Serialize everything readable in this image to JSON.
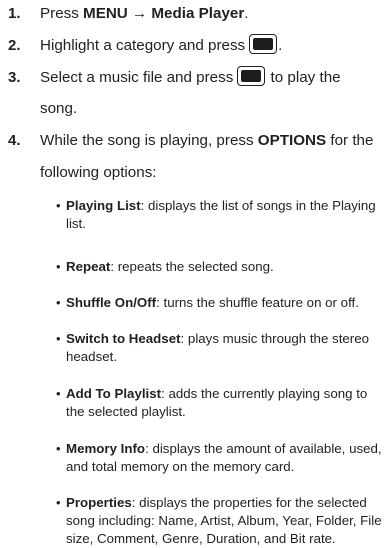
{
  "steps": [
    {
      "number": "1.",
      "parts": {
        "a": "Press ",
        "b": "MENU → Media Player",
        "c": "."
      }
    },
    {
      "number": "2.",
      "parts": {
        "a": "Highlight a category and press",
        "c": "."
      }
    },
    {
      "number": "3.",
      "parts": {
        "a": "Select a music file and press",
        "c": " to play the",
        "line2": "song."
      }
    },
    {
      "number": "4.",
      "parts": {
        "a": "While the song is playing, press ",
        "b": "OPTIONS",
        "c": " for the",
        "line2": "following options:"
      }
    }
  ],
  "key_icon_name": "ok-key-icon",
  "options": [
    {
      "term": "Playing List",
      "desc": ": displays the list of songs in the Playing list."
    },
    {
      "term": "Repeat",
      "desc": ": repeats the selected song."
    },
    {
      "term": "Shuffle On/Off",
      "desc": ": turns the shuffle feature on or off."
    },
    {
      "term": "Switch to Headset",
      "desc": ": plays music through the stereo headset."
    },
    {
      "term": "Add To Playlist",
      "desc": ": adds the currently playing song to the selected playlist."
    },
    {
      "term": "Memory Info",
      "desc": ": displays the amount of available, used, and total memory on the memory card."
    },
    {
      "term": "Properties",
      "desc": ": displays the properties for the selected song including: Name, Artist, Album, Year, Folder, File size, Comment, Genre, Duration, and Bit rate."
    }
  ]
}
